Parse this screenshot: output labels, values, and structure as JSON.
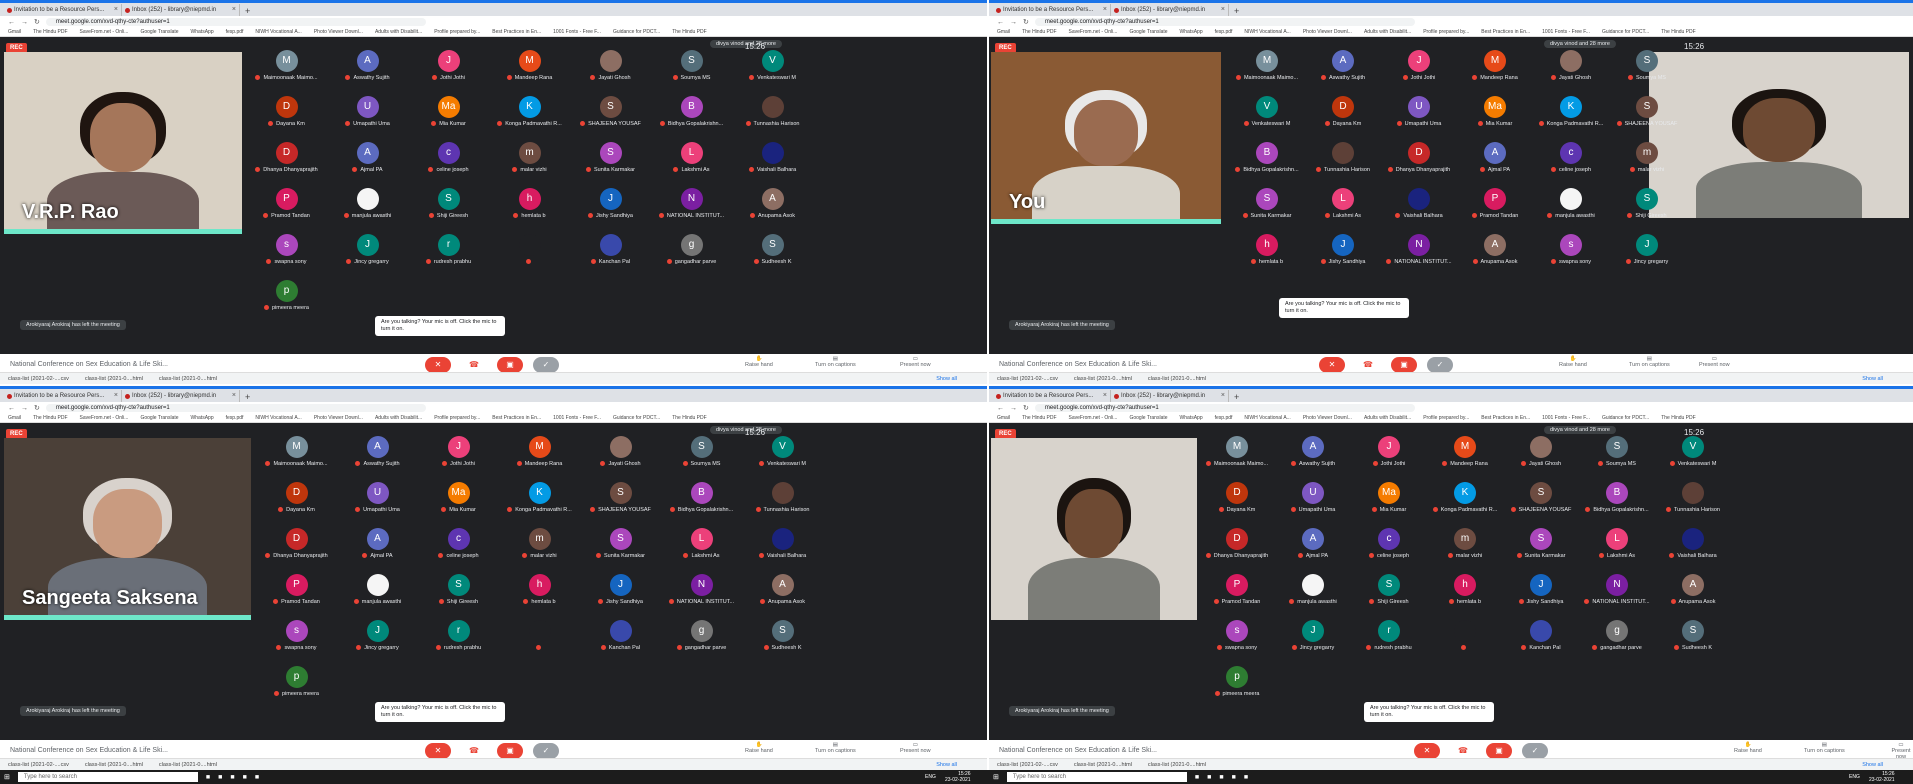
{
  "browser": {
    "tabs": [
      {
        "label": "Invitation to be a Resource Pers..."
      },
      {
        "label": "Inbox (252) - library@niepmd.in"
      },
      {
        "label": "Meet – National Conferenc..."
      }
    ],
    "new_tab": "+",
    "url": "meet.google.com/xvd-qthy-cte?authuser=1",
    "bookmarks": [
      "Gmail",
      "The Hindu PDF",
      "SaveFrom.net - Onli...",
      "Google Translate",
      "WhatsApp",
      "fesp.pdf",
      "NIWH Vocational A...",
      "Photo Viewer Downl...",
      "Adults with Disabilit...",
      "Profile prepared by...",
      "Best Practices in En...",
      "1001 Fonts - Free F...",
      "Guidance for PDCT...",
      "The Hindu PDF"
    ]
  },
  "meet": {
    "rec_label": "REC",
    "presenting_label": "divya vinod and 28 more",
    "time": "15:26",
    "left_toast": "Arokiyaraj Arokiraj has left the meeting",
    "mic_note": "Are you talking? Your mic is off. Click the mic to turn it on.",
    "meeting_title": "National Conference on Sex Education & Life Ski...",
    "raise_hand": "Raise hand",
    "captions": "Turn on captions",
    "present_now": "Present now",
    "speakers": [
      "V.R.P. Rao",
      "You",
      "Sangeeta Saksena"
    ],
    "participants": [
      {
        "initial": "M",
        "name": "Maimoonaak Maimo...",
        "color": "#78909c"
      },
      {
        "initial": "A",
        "name": "Aswathy Sujith",
        "color": "#5c6bc0"
      },
      {
        "initial": "J",
        "name": "Jothi Jothi",
        "color": "#ec407a"
      },
      {
        "initial": "M",
        "name": "Mandeep Rana",
        "color": "#e64a19"
      },
      {
        "initial": "",
        "name": "Jayati Ghosh",
        "color": "#8d6e63"
      },
      {
        "initial": "S",
        "name": "Soumya MS",
        "color": "#546e7a"
      },
      {
        "initial": "V",
        "name": "Venkateswari M",
        "color": "#00897b"
      },
      {
        "initial": "D",
        "name": "Dayana Km",
        "color": "#bf360c"
      },
      {
        "initial": "U",
        "name": "Umapathi Uma",
        "color": "#7e57c2"
      },
      {
        "initial": "Ma",
        "name": "Mia Kumar",
        "color": "#f57c00"
      },
      {
        "initial": "K",
        "name": "Konga Padmavathi R...",
        "color": "#039be5"
      },
      {
        "initial": "S",
        "name": "SHAJEENA YOUSAF",
        "color": "#6d4c41"
      },
      {
        "initial": "B",
        "name": "Bidhya Gopalakrishn...",
        "color": "#ab47bc"
      },
      {
        "initial": "",
        "name": "Tunnashia Harison",
        "color": "#5d4037"
      },
      {
        "initial": "D",
        "name": "Dhanya Dhanyaprajith",
        "color": "#c62828"
      },
      {
        "initial": "A",
        "name": "Ajmal PA",
        "color": "#5c6bc0"
      },
      {
        "initial": "c",
        "name": "celine joseph",
        "color": "#5e35b1"
      },
      {
        "initial": "m",
        "name": "malar vizhi",
        "color": "#6d4c41"
      },
      {
        "initial": "S",
        "name": "Sunita Karmakar",
        "color": "#ab47bc"
      },
      {
        "initial": "L",
        "name": "Lakshmi As",
        "color": "#ec407a"
      },
      {
        "initial": "",
        "name": "Vaishali Balhara",
        "color": "#1a237e"
      },
      {
        "initial": "P",
        "name": "Pramod Tandan",
        "color": "#d81b60"
      },
      {
        "initial": "",
        "name": "manjula awasthi",
        "color": "#f5f5f5"
      },
      {
        "initial": "S",
        "name": "Shiji Gireesh",
        "color": "#00897b"
      },
      {
        "initial": "h",
        "name": "hemlata b",
        "color": "#d81b60"
      },
      {
        "initial": "J",
        "name": "Jishy Sandhiya",
        "color": "#1565c0"
      },
      {
        "initial": "N",
        "name": "NATIONAL INSTITUT...",
        "color": "#7b1fa2"
      },
      {
        "initial": "A",
        "name": "Anupama Asok",
        "color": "#8d6e63"
      },
      {
        "initial": "s",
        "name": "swapna sony",
        "color": "#ab47bc"
      },
      {
        "initial": "J",
        "name": "Jincy gregarry",
        "color": "#00897b"
      },
      {
        "initial": "r",
        "name": "rudresh prabhu",
        "color": "#00897b"
      },
      {
        "initial": "",
        "name": "",
        "color": "#202124"
      },
      {
        "initial": "",
        "name": "Kanchan Pal",
        "color": "#3949ab"
      },
      {
        "initial": "g",
        "name": "gangadhar parve",
        "color": "#757575"
      },
      {
        "initial": "S",
        "name": "Sudheesh K",
        "color": "#546e7a"
      },
      {
        "initial": "p",
        "name": "pimeera meera",
        "color": "#2e7d32"
      }
    ]
  },
  "downloads": {
    "items": [
      "class-list (2021-02-....csv",
      "class-list (2021-0....html",
      "class-list (2021-0....html"
    ],
    "show_all": "Show all"
  },
  "taskbar": {
    "search_placeholder": "Type here to search",
    "time": "15:26",
    "date": "23-02-2021",
    "lang": "ENG"
  }
}
